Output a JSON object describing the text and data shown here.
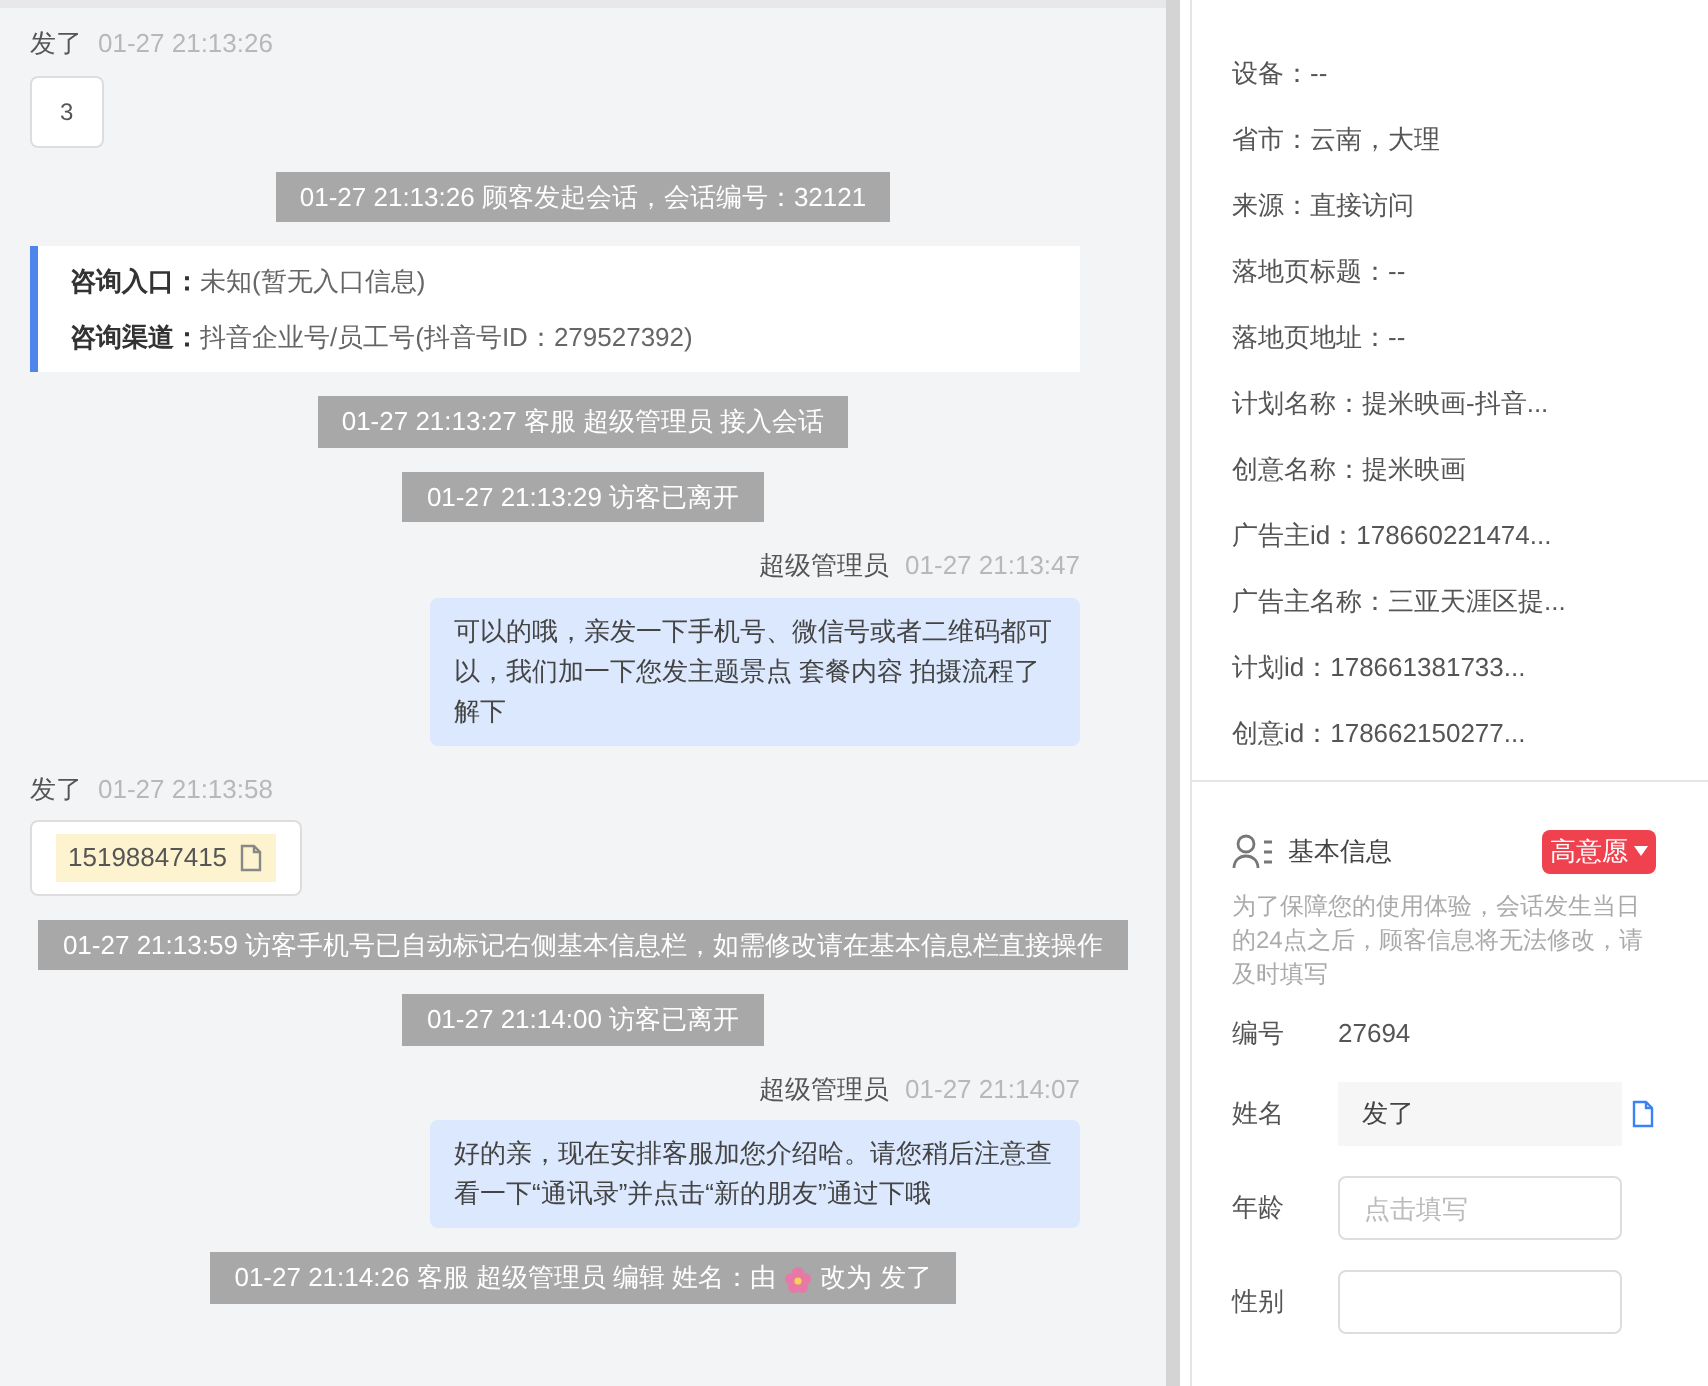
{
  "chat": {
    "messages": [
      {
        "kind": "incoming",
        "sender": "发了",
        "time": "01-27 21:13:26",
        "content": {
          "kind": "text",
          "text": "3"
        }
      },
      {
        "kind": "system",
        "parts": [
          "01-27 21:13:26 顾客发起会话，会话编号：32121"
        ]
      },
      {
        "kind": "info",
        "rows": [
          {
            "label": "咨询入口：",
            "value": "未知(暂无入口信息)"
          },
          {
            "label": "咨询渠道：",
            "value": "抖音企业号/员工号(抖音号ID：279527392)"
          }
        ]
      },
      {
        "kind": "system",
        "parts": [
          "01-27 21:13:27 客服 超级管理员 接入会话"
        ]
      },
      {
        "kind": "system",
        "parts": [
          "01-27 21:13:29 访客已离开"
        ]
      },
      {
        "kind": "outgoing",
        "sender": "超级管理员",
        "time": "01-27 21:13:47",
        "text": "可以的哦，亲发一下手机号、微信号或者二维码都可以，我们加一下您发主题景点 套餐内容 拍摄流程了解下"
      },
      {
        "kind": "incoming",
        "sender": "发了",
        "time": "01-27 21:13:58",
        "content": {
          "kind": "phone",
          "text": "15198847415"
        }
      },
      {
        "kind": "system",
        "parts": [
          "01-27 21:13:59 访客手机号已自动标记右侧基本信息栏，如需修改请在基本信息栏直接操作"
        ]
      },
      {
        "kind": "system",
        "parts": [
          "01-27 21:14:00 访客已离开"
        ]
      },
      {
        "kind": "outgoing",
        "sender": "超级管理员",
        "time": "01-27 21:14:07",
        "text": "好的亲，现在安排客服加您介绍哈。请您稍后注意查看一下“通讯录”并点击“新的朋友”通过下哦"
      },
      {
        "kind": "system",
        "parts": [
          "01-27 21:14:26 客服 超级管理员 编辑 姓名：由",
          "改为 发了"
        ]
      }
    ]
  },
  "source_info": {
    "rows": [
      "设备：--",
      "省市：云南，大理",
      "来源：直接访问",
      "落地页标题：--",
      "落地页地址：--",
      "计划名称：提米映画-抖音...",
      "创意名称：提米映画",
      "广告主id：178660221474...",
      "广告主名称：三亚天涯区提...",
      "计划id：178661381733...",
      "创意id：178662150277..."
    ]
  },
  "basic_info": {
    "title": "基本信息",
    "intent_tag": "高意愿",
    "notice": "为了保障您的使用体验，会话发生当日的24点之后，顾客信息将无法修改，请及时填写",
    "fields": [
      {
        "kind": "static",
        "label": "编号",
        "value": "27694"
      },
      {
        "kind": "filled",
        "label": "姓名",
        "value": "发了"
      },
      {
        "kind": "input",
        "label": "年龄",
        "placeholder": "点击填写"
      },
      {
        "kind": "input",
        "label": "性别"
      }
    ]
  }
}
